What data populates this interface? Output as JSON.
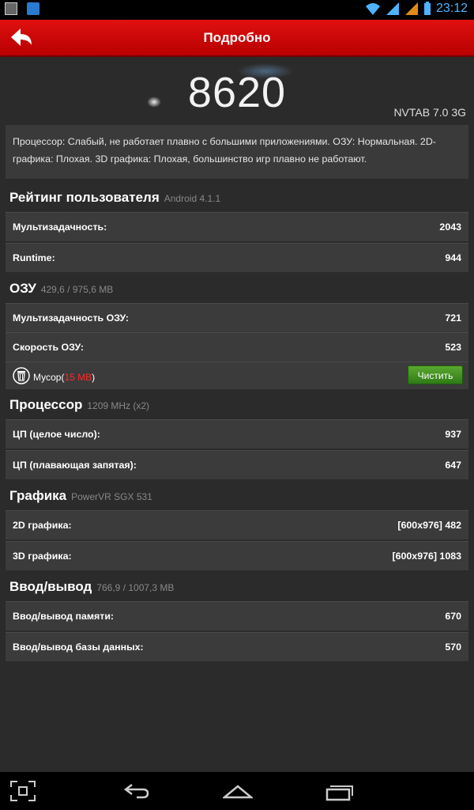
{
  "status_bar": {
    "time": "23:12"
  },
  "action_bar": {
    "title": "Подробно"
  },
  "score": {
    "value": "8620",
    "device": "NVTAB 7.0 3G"
  },
  "summary": "Процессор: Слабый, не работает плавно с большими приложениями. ОЗУ: Нормальная. 2D-графика: Плохая. 3D графика: Плохая, большинство игр плавно не работают.",
  "sections": {
    "user_rating": {
      "title": "Рейтинг пользователя",
      "sub": "Android 4.1.1",
      "rows": [
        {
          "label": "Мультизадачность:",
          "value": "2043"
        },
        {
          "label": "Runtime:",
          "value": "944"
        }
      ]
    },
    "ram": {
      "title": "ОЗУ",
      "sub": "429,6 / 975,6 MB",
      "rows": [
        {
          "label": "Мультизадачность ОЗУ:",
          "value": "721"
        },
        {
          "label": "Скорость ОЗУ:",
          "value": "523"
        }
      ],
      "junk_label": "Мусор(",
      "junk_size": "15 MB",
      "junk_close": ")",
      "clean_button": "Чистить"
    },
    "cpu": {
      "title": "Процессор",
      "sub": "1209 MHz (x2)",
      "rows": [
        {
          "label": "ЦП (целое число):",
          "value": "937"
        },
        {
          "label": "ЦП (плавающая запятая):",
          "value": "647"
        }
      ]
    },
    "graphics": {
      "title": "Графика",
      "sub": "PowerVR SGX 531",
      "rows": [
        {
          "label": "2D графика:",
          "value": "[600x976] 482"
        },
        {
          "label": "3D графика:",
          "value": "[600x976] 1083"
        }
      ]
    },
    "io": {
      "title": "Ввод/вывод",
      "sub": "766,9 / 1007,3 MB",
      "rows": [
        {
          "label": "Ввод/вывод памяти:",
          "value": "670"
        },
        {
          "label": "Ввод/вывод базы данных:",
          "value": "570"
        }
      ]
    }
  },
  "icons": {
    "back": "back-arrow-icon",
    "trash": "trash-icon",
    "nav": [
      "screenshot-icon",
      "back-icon",
      "home-icon",
      "recent-apps-icon"
    ]
  },
  "colors": {
    "action_bar": "#d40b0b",
    "clean_button": "#3f8f1f",
    "junk_size": "#ff2a2a",
    "clock": "#4db2ff"
  }
}
